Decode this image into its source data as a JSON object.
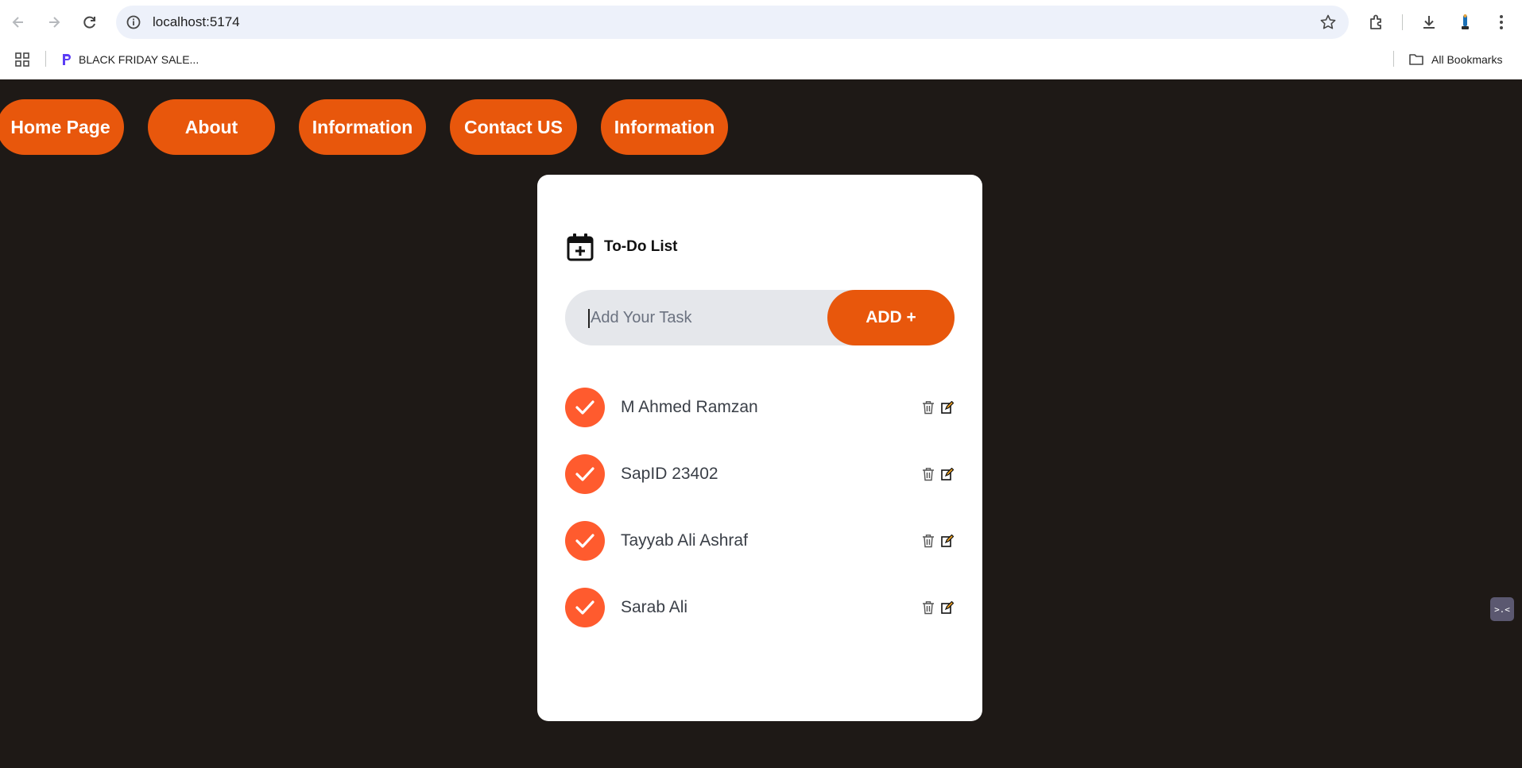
{
  "browser": {
    "url": "localhost:5174",
    "bookmarks": [
      {
        "label": "BLACK FRIDAY SALE..."
      }
    ],
    "all_bookmarks_label": "All Bookmarks"
  },
  "nav": {
    "items": [
      {
        "label": "Home Page"
      },
      {
        "label": "About"
      },
      {
        "label": "Information"
      },
      {
        "label": "Contact US"
      },
      {
        "label": "Information"
      }
    ]
  },
  "todo": {
    "title": "To-Do List",
    "input": {
      "placeholder": "Add Your Task",
      "value": ""
    },
    "add_label": "ADD +",
    "tasks": [
      {
        "text": "M Ahmed Ramzan",
        "done": true
      },
      {
        "text": "SapID 23402",
        "done": true
      },
      {
        "text": "Tayyab Ali Ashraf",
        "done": true
      },
      {
        "text": "Sarab Ali",
        "done": true
      }
    ]
  },
  "colors": {
    "accent": "#e8570c",
    "check": "#ff5b2e",
    "background": "#1e1916",
    "card": "#ffffff"
  },
  "floating_badge": ">.<"
}
